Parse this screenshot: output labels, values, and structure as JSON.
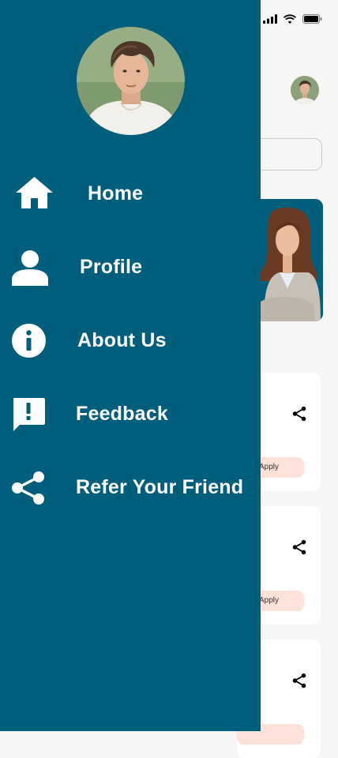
{
  "colors": {
    "drawer_bg": "#005e7d",
    "menu_text": "#ffffff",
    "apply_chip_bg": "#fde2d9",
    "background": "#f6f6f7"
  },
  "status_bar": {
    "icons": [
      "signal-icon",
      "wifi-icon",
      "battery-icon"
    ]
  },
  "drawer": {
    "avatar_icon": "user-avatar",
    "menu": [
      {
        "label": "Home",
        "icon": "home-icon"
      },
      {
        "label": "Profile",
        "icon": "person-icon"
      },
      {
        "label": "About Us",
        "icon": "info-icon"
      },
      {
        "label": "Feedback",
        "icon": "feedback-icon"
      },
      {
        "label": "Refer Your Friend",
        "icon": "share-icon"
      }
    ]
  },
  "background_screen": {
    "apply_label": "Apply"
  }
}
